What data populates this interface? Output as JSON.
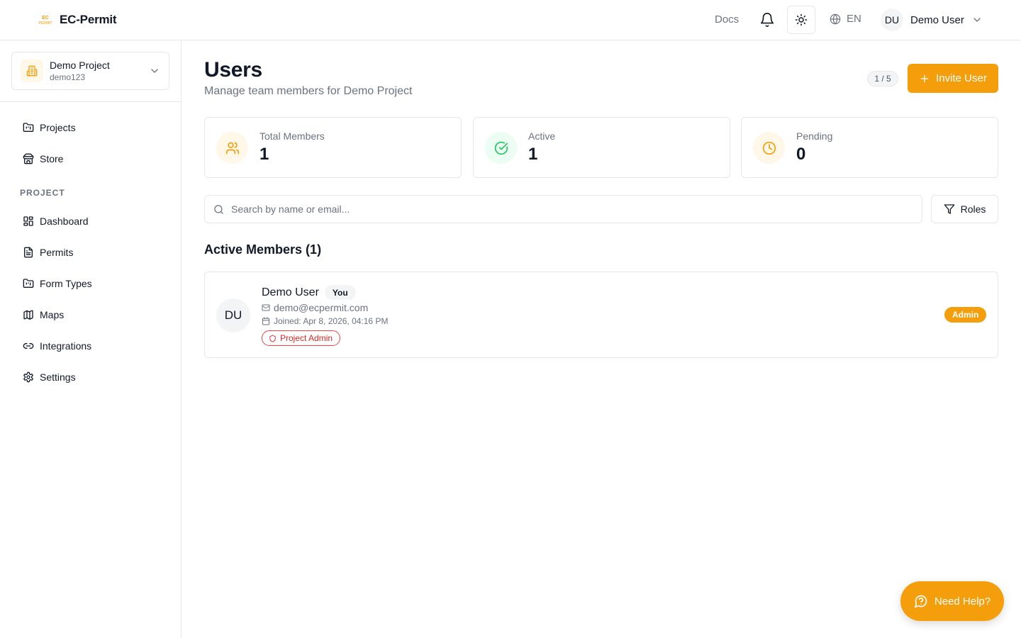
{
  "header": {
    "brand_logo_text": "EC PERMIT",
    "brand_name": "EC-Permit",
    "docs_label": "Docs",
    "language": "EN",
    "user_initials": "DU",
    "user_name": "Demo User"
  },
  "sidebar": {
    "project_name": "Demo Project",
    "project_code": "demo123",
    "section_label": "PROJECT",
    "global_items": [
      {
        "label": "Projects",
        "icon": "folder-icon"
      },
      {
        "label": "Store",
        "icon": "store-icon"
      }
    ],
    "project_items": [
      {
        "label": "Dashboard",
        "icon": "dashboard-icon"
      },
      {
        "label": "Permits",
        "icon": "document-icon"
      },
      {
        "label": "Form Types",
        "icon": "folder-icon"
      },
      {
        "label": "Maps",
        "icon": "map-icon"
      },
      {
        "label": "Integrations",
        "icon": "link-icon"
      },
      {
        "label": "Settings",
        "icon": "gear-icon"
      }
    ]
  },
  "main": {
    "title": "Users",
    "subtitle": "Manage team members for Demo Project",
    "user_count": "1 / 5",
    "invite_label": "Invite User",
    "stats": [
      {
        "label": "Total Members",
        "value": "1",
        "icon": "users-icon",
        "color": "#f59e0b",
        "bg": "#fff7e8"
      },
      {
        "label": "Active",
        "value": "1",
        "icon": "check-circle-icon",
        "color": "#22c55e",
        "bg": "#ecfdf3"
      },
      {
        "label": "Pending",
        "value": "0",
        "icon": "clock-icon",
        "color": "#f59e0b",
        "bg": "#fff7e8"
      }
    ],
    "search_placeholder": "Search by name or email...",
    "roles_label": "Roles",
    "section_title": "Active Members (1)",
    "members": [
      {
        "initials": "DU",
        "name": "Demo User",
        "you_badge": "You",
        "email": "demo@ecpermit.com",
        "joined": "Joined: Apr 8, 2026, 04:16 PM",
        "role_tag": "Project Admin",
        "role_badge": "Admin"
      }
    ]
  },
  "help": {
    "label": "Need Help?"
  },
  "colors": {
    "accent": "#f59e0b",
    "success": "#22c55e",
    "danger": "#dc2626",
    "border": "#e5e7eb",
    "muted_text": "#6b7280"
  }
}
